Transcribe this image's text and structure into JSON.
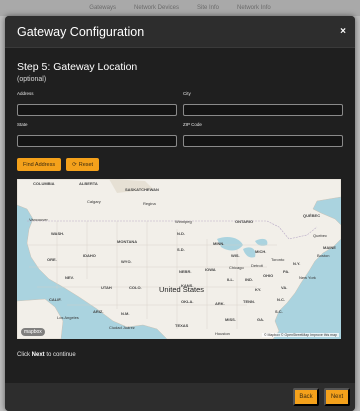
{
  "top_bar": {
    "items": [
      "Gateways",
      "Network Devices",
      "Site Info",
      "Network Info"
    ]
  },
  "modal": {
    "title": "Gateway Configuration",
    "close_label": "×"
  },
  "step": {
    "title": "Step 5: Gateway Location",
    "subtitle": "(optional)"
  },
  "form": {
    "address": {
      "label": "Address",
      "value": ""
    },
    "city": {
      "label": "City",
      "value": ""
    },
    "state": {
      "label": "State",
      "value": ""
    },
    "zip": {
      "label": "ZIP Code",
      "value": ""
    }
  },
  "buttons": {
    "find_address": "Find Address",
    "reset": "Reset",
    "reset_icon": "refresh-icon"
  },
  "map": {
    "country_label": "United States",
    "labels": [
      "COLUMBIA",
      "ALBERTA",
      "SASKATCHEWAN",
      "ONTARIO",
      "QUÉBEC",
      "WASH.",
      "MONTANA",
      "N.D.",
      "MINN.",
      "MAINE",
      "ORE.",
      "IDAHO",
      "WYO.",
      "S.D.",
      "WIS.",
      "MICH.",
      "NEBR.",
      "IOWA",
      "N.Y.",
      "NEV.",
      "UTAH",
      "COLO.",
      "KANS.",
      "ILL.",
      "IND.",
      "OHIO",
      "PA.",
      "CALIF.",
      "ARIZ.",
      "N.M.",
      "OKLA.",
      "ARK.",
      "TENN.",
      "N.C.",
      "TEXAS",
      "MISS.",
      "GA.",
      "S.C.",
      "KY.",
      "VA.",
      "Calgary",
      "Regina",
      "Vancouver",
      "Winnipeg",
      "Quebec",
      "Toronto",
      "Detroit",
      "Chicago",
      "Boston",
      "New York",
      "Los Angeles",
      "Ciudad Juárez",
      "Houston"
    ],
    "logo": "mapbox",
    "attribution": "© Mapbox © OpenStreetMap Improve this map"
  },
  "hint": {
    "prefix": "Click",
    "bold": "Next",
    "suffix": "to continue"
  },
  "footer": {
    "back": "Back",
    "next": "Next"
  },
  "colors": {
    "accent": "#f4a11b",
    "modal_bg": "#1f1f1f",
    "header_bg": "#2d2d2d",
    "water": "#aad3df",
    "land": "#f2efe9"
  }
}
